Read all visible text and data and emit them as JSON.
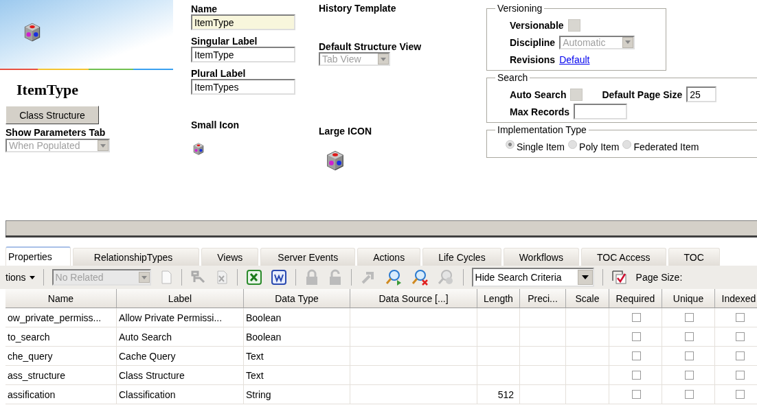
{
  "header": {
    "title": "ItemType",
    "class_structure_button": "Class Structure",
    "show_parameters_tab": {
      "label": "Show Parameters Tab",
      "value": "When Populated"
    }
  },
  "fields": {
    "name": {
      "label": "Name",
      "value": "ItemType"
    },
    "singular_label": {
      "label": "Singular Label",
      "value": "ItemType"
    },
    "plural_label": {
      "label": "Plural Label",
      "value": "ItemTypes"
    },
    "small_icon": {
      "label": "Small Icon"
    },
    "history_template": {
      "label": "History Template"
    },
    "default_structure_view": {
      "label": "Default Structure View",
      "value": "Tab View"
    },
    "large_icon": {
      "label": "Large ICON"
    }
  },
  "versioning": {
    "legend": "Versioning",
    "versionable": {
      "label": "Versionable",
      "checked": false
    },
    "discipline": {
      "label": "Discipline",
      "value": "Automatic"
    },
    "revisions": {
      "label": "Revisions",
      "link": "Default"
    }
  },
  "search": {
    "legend": "Search",
    "auto_search": {
      "label": "Auto Search",
      "checked": false
    },
    "default_page_size": {
      "label": "Default Page Size",
      "value": "25"
    },
    "max_records": {
      "label": "Max Records"
    }
  },
  "implementation_type": {
    "legend": "Implementation Type",
    "options": [
      {
        "label": "Single Item",
        "selected": true
      },
      {
        "label": "Poly Item",
        "selected": false
      },
      {
        "label": "Federated Item",
        "selected": false
      }
    ]
  },
  "tabs": [
    {
      "label": "Properties",
      "selected": true
    },
    {
      "label": "RelationshipTypes",
      "selected": false
    },
    {
      "label": "Views",
      "selected": false
    },
    {
      "label": "Server Events",
      "selected": false
    },
    {
      "label": "Actions",
      "selected": false
    },
    {
      "label": "Life Cycles",
      "selected": false
    },
    {
      "label": "Workflows",
      "selected": false
    },
    {
      "label": "TOC Access",
      "selected": false
    },
    {
      "label": "TOC",
      "selected": false
    }
  ],
  "toolbar": {
    "actions_menu": "tions",
    "related_select": "No Related",
    "search_mode": "Hide Search Criteria",
    "page_size_label": "Page Size:"
  },
  "table": {
    "columns": [
      "Name",
      "Label",
      "Data Type",
      "Data Source [...]",
      "Length",
      "Preci...",
      "Scale",
      "Required",
      "Unique",
      "Indexed"
    ],
    "rows": [
      {
        "cells": [
          "ow_private_permiss...",
          "Allow Private Permissi...",
          "Boolean",
          "",
          "",
          "",
          ""
        ],
        "required": false,
        "unique": false,
        "indexed": false
      },
      {
        "cells": [
          "to_search",
          "Auto Search",
          "Boolean",
          "",
          "",
          "",
          ""
        ],
        "required": false,
        "unique": false,
        "indexed": false
      },
      {
        "cells": [
          "che_query",
          "Cache Query",
          "Text",
          "",
          "",
          "",
          ""
        ],
        "required": false,
        "unique": false,
        "indexed": false
      },
      {
        "cells": [
          "ass_structure",
          "Class Structure",
          "Text",
          "",
          "",
          "",
          ""
        ],
        "required": false,
        "unique": false,
        "indexed": false
      },
      {
        "cells": [
          "assification",
          "Classification",
          "String",
          "",
          "512",
          "",
          ""
        ],
        "required": false,
        "unique": false,
        "indexed": false
      }
    ]
  }
}
